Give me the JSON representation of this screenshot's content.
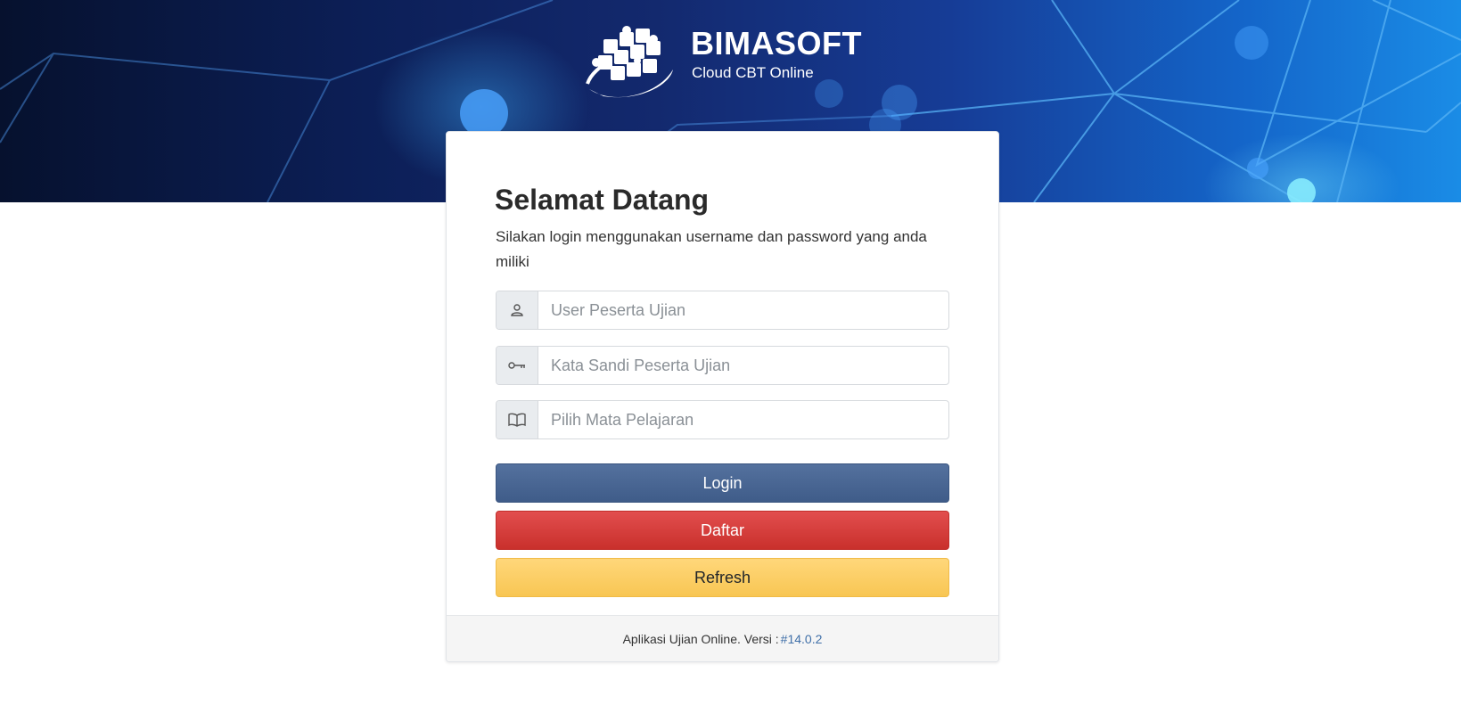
{
  "header": {
    "brand_name": "BIMASOFT",
    "brand_tagline": "Cloud CBT Online",
    "logo_icon": "puzzle-globe-icon"
  },
  "login_card": {
    "title": "Selamat Datang",
    "description": "Silakan login menggunakan username dan password yang anda miliki",
    "fields": {
      "username": {
        "icon": "user-icon",
        "placeholder": "User Peserta Ujian",
        "value": ""
      },
      "password": {
        "icon": "key-icon",
        "placeholder": "Kata Sandi Peserta Ujian",
        "value": ""
      },
      "subject": {
        "icon": "book-icon",
        "placeholder": "Pilih Mata Pelajaran",
        "value": ""
      }
    },
    "buttons": {
      "login": "Login",
      "register": "Daftar",
      "refresh": "Refresh"
    },
    "footer": {
      "text": "Aplikasi Ujian Online. Versi :",
      "version": "#14.0.2"
    }
  },
  "colors": {
    "login_button": "#4a6895",
    "register_button": "#d43d3a",
    "refresh_button": "#fccc63",
    "hero_dark": "#06112e",
    "hero_light": "#1a8ce6"
  }
}
